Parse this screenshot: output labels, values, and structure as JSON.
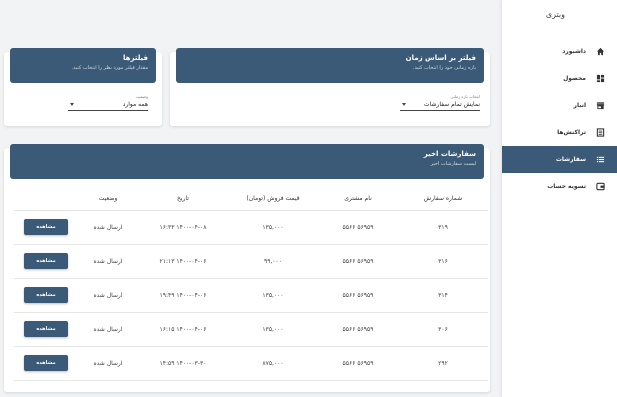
{
  "brand": "وبتری",
  "sidebar": {
    "items": [
      {
        "label": "داشبورد",
        "icon": "home-icon"
      },
      {
        "label": "محصول",
        "icon": "dashboard-icon"
      },
      {
        "label": "انبار",
        "icon": "store-icon"
      },
      {
        "label": "تراکنش‌ها",
        "icon": "receipt-icon"
      },
      {
        "label": "سفارشات",
        "icon": "list-icon"
      },
      {
        "label": "تسویه حساب",
        "icon": "wallet-icon"
      }
    ],
    "active_index": 4
  },
  "time_filter": {
    "title": "فیلتر بر اساس زمان",
    "subtitle": "بازه زمانی خود را انتخاب کنید.",
    "field_label": "انتخاب بازه زمانی",
    "field_value": "نمایش تمام سفارشات"
  },
  "filters": {
    "title": "فیلترها",
    "subtitle": "مقدار فیلتر مورد نظر را انتخاب کنید.",
    "field_label": "وضعیت",
    "field_value": "همه موارد"
  },
  "orders": {
    "title": "سفارشات اخیر",
    "subtitle": "لیست سفارشات اخیر",
    "columns": [
      "شماره سفارش",
      "نام مشتری",
      "قیمت فروش (تومان)",
      "تاریخ",
      "وضعیت",
      ""
    ],
    "rows": [
      {
        "id": "۳۱۹",
        "customer": "۵۶۹۵۹ ۵۵۶۶",
        "price": "۱۳۵,۰۰۰",
        "date": "۱۴۰۰-۰۴-۰۸ ۱۶:۳۳",
        "status": "ارسال شده",
        "action": "مشاهده"
      },
      {
        "id": "۳۱۶",
        "customer": "۵۶۹۵۹ ۵۵۶۶",
        "price": "۹۹,۰۰۰",
        "date": "۱۴۰۰-۰۴-۰۶ ۲۱:۱۳",
        "status": "ارسال شده",
        "action": "مشاهده"
      },
      {
        "id": "۳۱۴",
        "customer": "۵۶۹۵۹ ۵۵۶۶",
        "price": "۱۳۵,۰۰۰",
        "date": "۱۴۰۰-۰۴-۰۶ ۱۹:۴۹",
        "status": "ارسال شده",
        "action": "مشاهده"
      },
      {
        "id": "۳۰۶",
        "customer": "۵۶۹۵۹ ۵۵۶۶",
        "price": "۱۳۵,۰۰۰",
        "date": "۱۴۰۰-۰۴-۰۶ ۱۶:۱۵",
        "status": "ارسال شده",
        "action": "مشاهده"
      },
      {
        "id": "۲۹۲",
        "customer": "۵۶۹۵۹ ۵۵۶۶",
        "price": "۸۷۵,۰۰۰",
        "date": "۱۴۰۰-۰۳-۳۰ ۱۴:۵۹",
        "status": "ارسال شده",
        "action": "مشاهده"
      }
    ]
  },
  "colors": {
    "primary": "#3b5a78",
    "background": "#f2f3f5"
  }
}
